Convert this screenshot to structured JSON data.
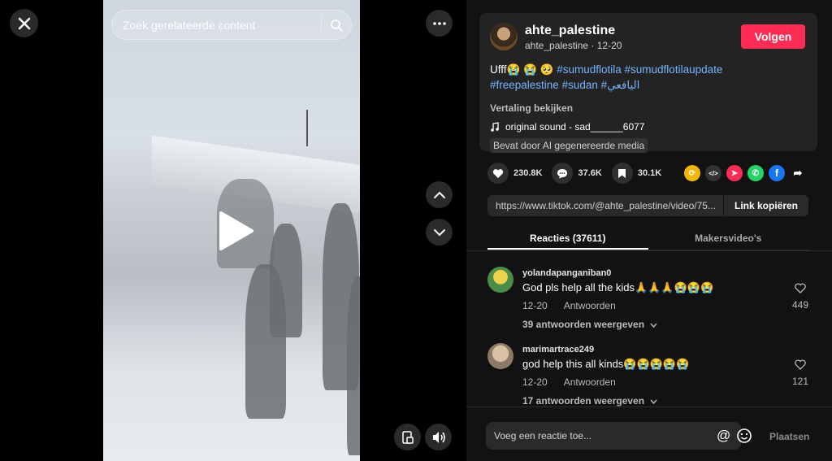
{
  "player": {
    "search_placeholder": "Zoek gerelateerde content"
  },
  "post": {
    "username": "ahte_palestine",
    "handle": "ahte_palestine",
    "date": "12-20",
    "follow_label": "Volgen",
    "description_prefix": "Ufff😭 😭 🥺",
    "hashtags_line1": [
      "#sumudflotila",
      "#sumudflotilaupdate"
    ],
    "hashtags_line2": [
      "#freepalestine",
      "#sudan",
      "#اليافعي"
    ],
    "translate_label": "Vertaling bekijken",
    "sound": "original sound - sad______6077",
    "ai_label": "Bevat door AI gegenereerde media"
  },
  "stats": {
    "likes": "230.8K",
    "comments": "37.6K",
    "saves": "30.1K"
  },
  "share": {
    "url": "https://www.tiktok.com/@ahte_palestine/video/75...",
    "copy_label": "Link kopiëren"
  },
  "tabs": [
    {
      "label": "Reacties (37611)"
    },
    {
      "label": "Makersvideo's"
    }
  ],
  "comments": [
    {
      "user": "yolandapanganiban0",
      "text": "God pls help all the kids🙏🙏🙏😭😭😭",
      "date": "12-20",
      "reply_label": "Antwoorden",
      "replies": "39 antwoorden weergeven",
      "likes": "449"
    },
    {
      "user": "marimartrace249",
      "text": "god help this all kinds😭😭😭😭😭",
      "date": "12-20",
      "reply_label": "Antwoorden",
      "replies": "17 antwoorden weergeven",
      "likes": "121"
    }
  ],
  "composer": {
    "placeholder": "Voeg een reactie toe...",
    "post_label": "Plaatsen"
  },
  "colors": {
    "accent": "#fe2c55",
    "hashtag": "#74b3ff",
    "panel_bg": "#121212"
  }
}
